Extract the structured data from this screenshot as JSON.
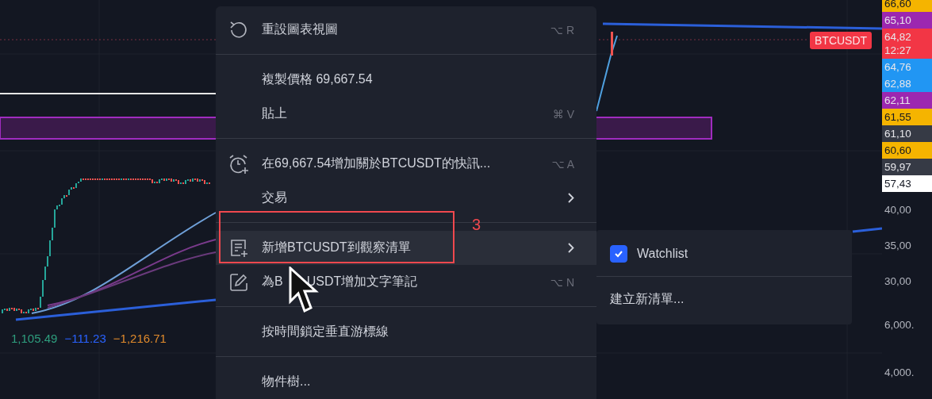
{
  "chart": {
    "symbol_tag": "BTCUSDT",
    "indicator_values": [
      {
        "text": "1,105.49",
        "color": "#2e9e7e"
      },
      {
        "text": "−111.23",
        "color": "#2962ff"
      },
      {
        "text": "−1,216.71",
        "color": "#e08a2c"
      }
    ]
  },
  "price_axis": {
    "tags": [
      {
        "text": "66,60",
        "color": "#f5b400"
      },
      {
        "text": "65,10",
        "color": "#9c27b0"
      },
      {
        "text": "64,82",
        "sub": "12:27",
        "color": "#f23645"
      },
      {
        "text": "64,76",
        "color": "#2196f3"
      },
      {
        "text": "62,88",
        "color": "#2196f3"
      },
      {
        "text": "62,11",
        "color": "#9c27b0"
      },
      {
        "text": "61,55",
        "color": "#f5b400"
      },
      {
        "text": "61,10",
        "color": "#363a45"
      },
      {
        "text": "60,60",
        "color": "#f5b400"
      },
      {
        "text": "59,97",
        "color": "#363a45"
      },
      {
        "text": "57,43",
        "color": "#ffffff"
      }
    ],
    "scale": [
      "40,00",
      "35,00",
      "30,00",
      "6,000.",
      "4,000."
    ]
  },
  "context_menu": {
    "items": [
      {
        "kind": "reset",
        "label": "重設圖表視圖",
        "shortcut": "⌥ R",
        "submenu": false,
        "selected": false,
        "divider_after": true
      },
      {
        "kind": "plain",
        "label": "複製價格 69,667.54",
        "submenu": false,
        "selected": false,
        "divider_after": false
      },
      {
        "kind": "plain",
        "label": "貼上",
        "shortcut": "⌘ V",
        "submenu": false,
        "selected": false,
        "divider_after": true
      },
      {
        "kind": "alarm",
        "label": "在69,667.54增加關於BTCUSDT的快訊...",
        "shortcut": "⌥ A",
        "submenu": false,
        "selected": false,
        "divider_after": false
      },
      {
        "kind": "plain",
        "label": "交易",
        "submenu": true,
        "selected": false,
        "divider_after": true
      },
      {
        "kind": "watchlist",
        "label": "新增BTCUSDT到觀察清單",
        "submenu": true,
        "selected": true,
        "divider_after": false
      },
      {
        "kind": "note",
        "label": "為B",
        "label_after_cursor": "USDT增加文字筆記",
        "shortcut": "⌥ N",
        "submenu": false,
        "selected": false,
        "divider_after": true
      },
      {
        "kind": "plain",
        "label": "按時間鎖定垂直游標線",
        "submenu": false,
        "selected": false,
        "divider_after": true
      },
      {
        "kind": "plain",
        "label": "物件樹...",
        "submenu": false,
        "selected": false,
        "divider_after": false
      }
    ]
  },
  "submenu": {
    "items": [
      {
        "kind": "checkbox",
        "label": "Watchlist",
        "checked": true
      },
      {
        "kind": "action",
        "label": "建立新清單..."
      }
    ]
  },
  "annotation": {
    "number": "3"
  }
}
